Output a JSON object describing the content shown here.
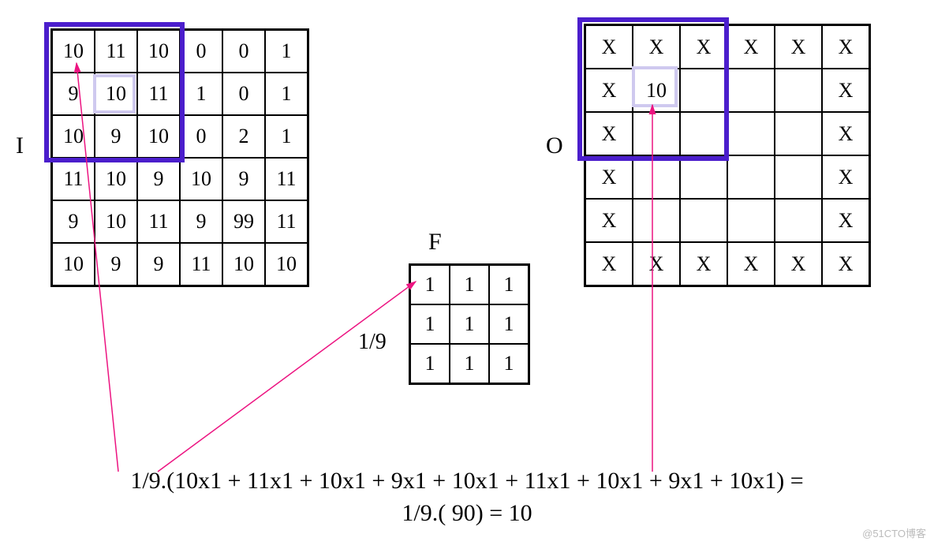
{
  "labels": {
    "I": "I",
    "F": "F",
    "O": "O",
    "coef": "1/9"
  },
  "matrixI": [
    [
      "10",
      "11",
      "10",
      "0",
      "0",
      "1"
    ],
    [
      "9",
      "10",
      "11",
      "1",
      "0",
      "1"
    ],
    [
      "10",
      "9",
      "10",
      "0",
      "2",
      "1"
    ],
    [
      "11",
      "10",
      "9",
      "10",
      "9",
      "11"
    ],
    [
      "9",
      "10",
      "11",
      "9",
      "99",
      "11"
    ],
    [
      "10",
      "9",
      "9",
      "11",
      "10",
      "10"
    ]
  ],
  "matrixF": [
    [
      "1",
      "1",
      "1"
    ],
    [
      "1",
      "1",
      "1"
    ],
    [
      "1",
      "1",
      "1"
    ]
  ],
  "matrixO": [
    [
      "X",
      "X",
      "X",
      "X",
      "X",
      "X"
    ],
    [
      "X",
      "10",
      "",
      "",
      "",
      "X"
    ],
    [
      "X",
      "",
      "",
      "",
      "",
      "X"
    ],
    [
      "X",
      "",
      "",
      "",
      "",
      "X"
    ],
    [
      "X",
      "",
      "",
      "",
      "",
      "X"
    ],
    [
      "X",
      "X",
      "X",
      "X",
      "X",
      "X"
    ]
  ],
  "equation": {
    "line1": "1/9.(10x1 + 11x1 + 10x1 + 9x1 + 10x1 + 11x1 + 10x1 + 9x1 + 10x1) =",
    "line2": "1/9.( 90) = 10"
  },
  "watermark": "@51CTO博客"
}
